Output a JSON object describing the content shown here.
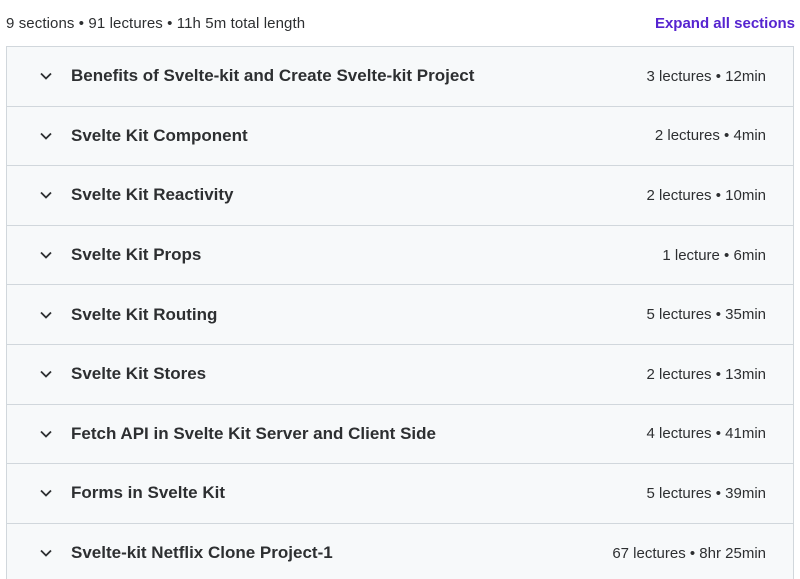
{
  "summary": {
    "text": "9 sections • 91 lectures • 11h 5m total length",
    "expand_label": "Expand all sections"
  },
  "sections": [
    {
      "title": "Benefits of Svelte-kit and Create Svelte-kit Project",
      "meta": "3 lectures • 12min",
      "icon": "chevron-down-icon"
    },
    {
      "title": "Svelte Kit Component",
      "meta": "2 lectures • 4min",
      "icon": "chevron-down-icon"
    },
    {
      "title": "Svelte Kit Reactivity",
      "meta": "2 lectures • 10min",
      "icon": "chevron-down-icon"
    },
    {
      "title": "Svelte Kit Props",
      "meta": "1 lecture • 6min",
      "icon": "chevron-down-icon"
    },
    {
      "title": "Svelte Kit Routing",
      "meta": "5 lectures • 35min",
      "icon": "chevron-down-icon"
    },
    {
      "title": "Svelte Kit Stores",
      "meta": "2 lectures • 13min",
      "icon": "chevron-down-icon"
    },
    {
      "title": "Fetch API in Svelte Kit Server and Client Side",
      "meta": "4 lectures • 41min",
      "icon": "chevron-down-icon"
    },
    {
      "title": "Forms in Svelte Kit",
      "meta": "5 lectures • 39min",
      "icon": "chevron-down-icon"
    },
    {
      "title": "Svelte-kit Netflix Clone Project-1",
      "meta": "67 lectures • 8hr 25min",
      "icon": "chevron-down-icon"
    }
  ],
  "colors": {
    "accent": "#5624d0",
    "row_background": "#f7f9fa",
    "border": "#d1d7dc",
    "text": "#2d2f31"
  }
}
